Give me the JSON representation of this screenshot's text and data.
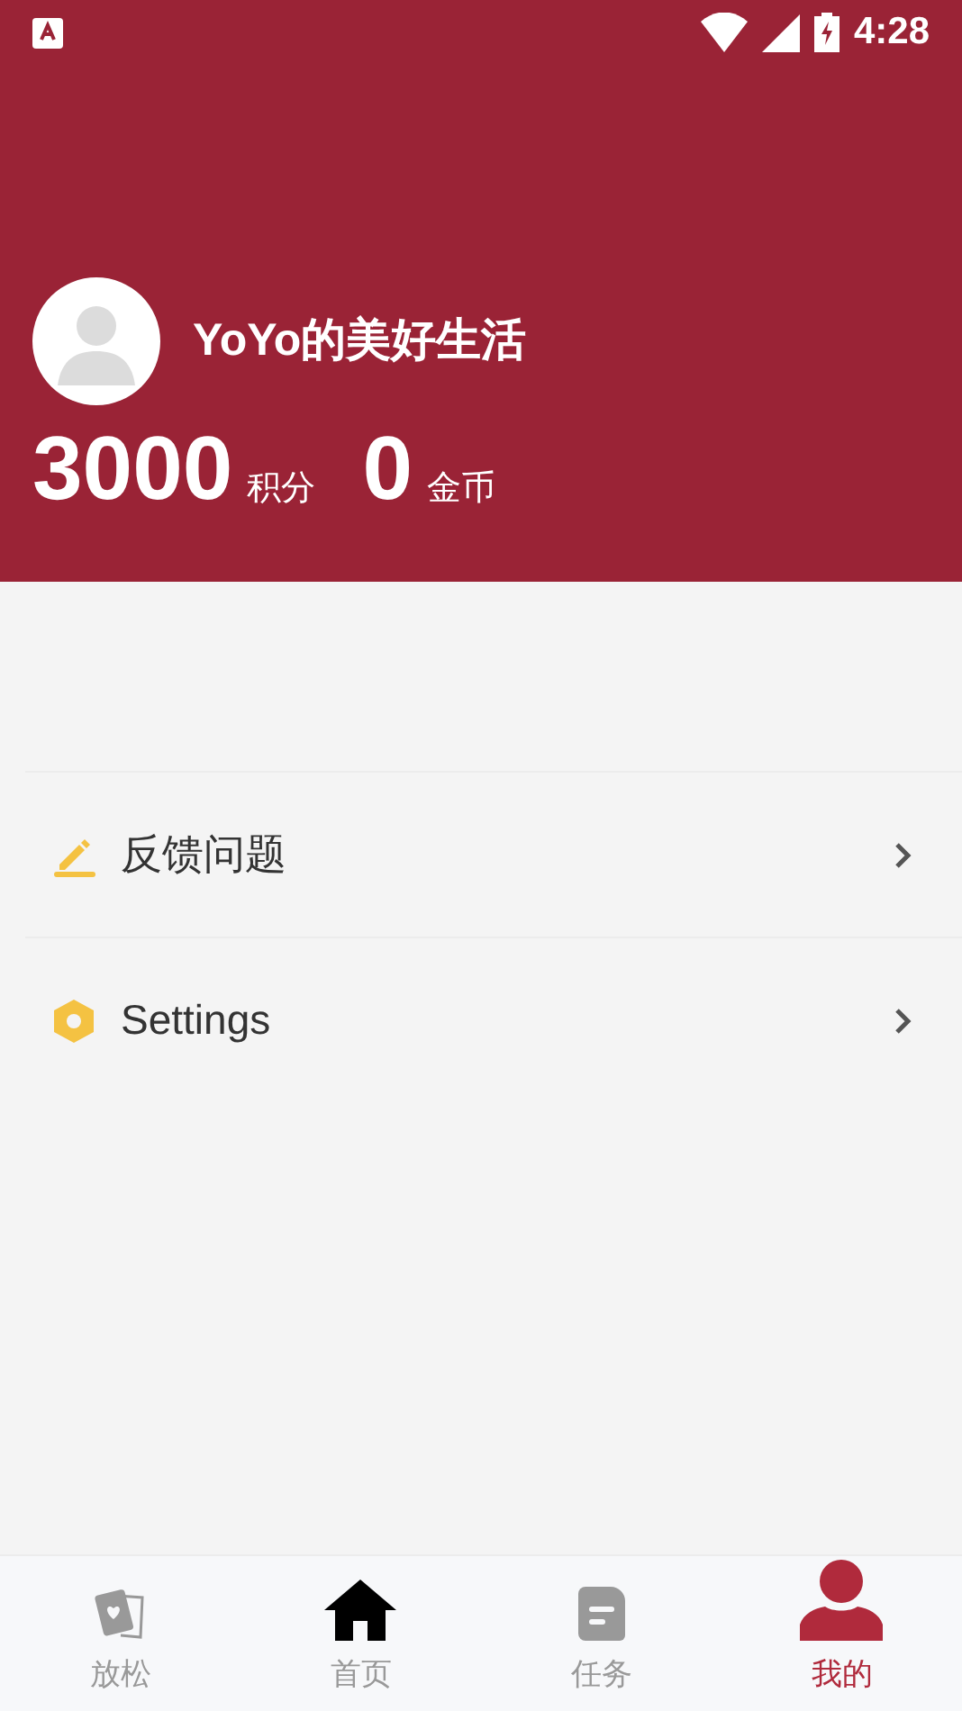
{
  "status_bar": {
    "time": "4:28"
  },
  "profile": {
    "name": "YoYo的美好生活",
    "stats": [
      {
        "value": "3000",
        "unit": "积分"
      },
      {
        "value": "0",
        "unit": "金币"
      }
    ]
  },
  "menu": [
    {
      "kind": "edit",
      "label": "反馈问题"
    },
    {
      "kind": "settings",
      "label": "Settings"
    }
  ],
  "bottom_nav": [
    {
      "kind": "relax",
      "label": "放松",
      "selected": false
    },
    {
      "kind": "home",
      "label": "首页",
      "selected": false
    },
    {
      "kind": "task",
      "label": "任务",
      "selected": false
    },
    {
      "kind": "me",
      "label": "我的",
      "selected": true
    }
  ]
}
